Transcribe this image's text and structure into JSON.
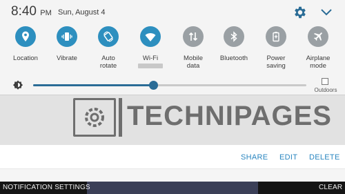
{
  "status_bar": {
    "time": "8:40",
    "ampm": "PM",
    "date": "Sun, August 4"
  },
  "quick_toggles": [
    {
      "label": "Location",
      "icon": "location-pin-icon",
      "active": true
    },
    {
      "label": "Vibrate",
      "icon": "vibrate-icon",
      "active": true
    },
    {
      "label": "Auto\nrotate",
      "icon": "auto-rotate-icon",
      "active": true
    },
    {
      "label": "Wi-Fi",
      "icon": "wifi-icon",
      "active": true
    },
    {
      "label": "Mobile\ndata",
      "icon": "mobile-data-icon",
      "active": false
    },
    {
      "label": "Bluetooth",
      "icon": "bluetooth-icon",
      "active": false
    },
    {
      "label": "Power\nsaving",
      "icon": "power-saving-icon",
      "active": false
    },
    {
      "label": "Airplane\nmode",
      "icon": "airplane-icon",
      "active": false
    }
  ],
  "brightness": {
    "level": 0.44,
    "outdoors_label": "Outdoors",
    "outdoors_checked": false
  },
  "background_page": {
    "logo_text": "TECHNIPAGES"
  },
  "notification": {
    "actions": [
      "SHARE",
      "EDIT",
      "DELETE"
    ]
  },
  "bottom_bar": {
    "left_label": "NOTIFICATION SETTINGS",
    "right_label": "CLEAR"
  },
  "colors": {
    "active_toggle": "#2d8fbf",
    "inactive_toggle": "#9aa0a4",
    "accent_text": "#2a86c0",
    "slider": "#2a6c96"
  }
}
